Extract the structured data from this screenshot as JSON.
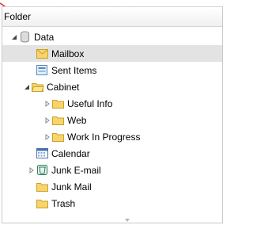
{
  "header": {
    "title": "Folder"
  },
  "tree": [
    {
      "label": "Data",
      "icon": "data-store-icon",
      "expander": "expanded"
    },
    {
      "label": "Mailbox",
      "icon": "mailbox-icon",
      "expander": "none",
      "selected": true
    },
    {
      "label": "Sent Items",
      "icon": "sent-items-icon",
      "expander": "none"
    },
    {
      "label": "Cabinet",
      "icon": "folder-open-icon",
      "expander": "expanded"
    },
    {
      "label": "Useful Info",
      "icon": "folder-icon",
      "expander": "collapsed"
    },
    {
      "label": "Web",
      "icon": "folder-icon",
      "expander": "collapsed"
    },
    {
      "label": "Work In Progress",
      "icon": "folder-icon",
      "expander": "collapsed"
    },
    {
      "label": "Calendar",
      "icon": "calendar-icon",
      "expander": "none"
    },
    {
      "label": "Junk E-mail",
      "icon": "junk-email-icon",
      "expander": "collapsed"
    },
    {
      "label": "Junk Mail",
      "icon": "folder-icon",
      "expander": "none"
    },
    {
      "label": "Trash",
      "icon": "folder-icon",
      "expander": "none"
    }
  ],
  "colors": {
    "selected_row": "#e3e3e3",
    "folder_fill": "#f7d56b",
    "folder_stroke": "#c9a227",
    "accent_red": "#d62b2b"
  }
}
